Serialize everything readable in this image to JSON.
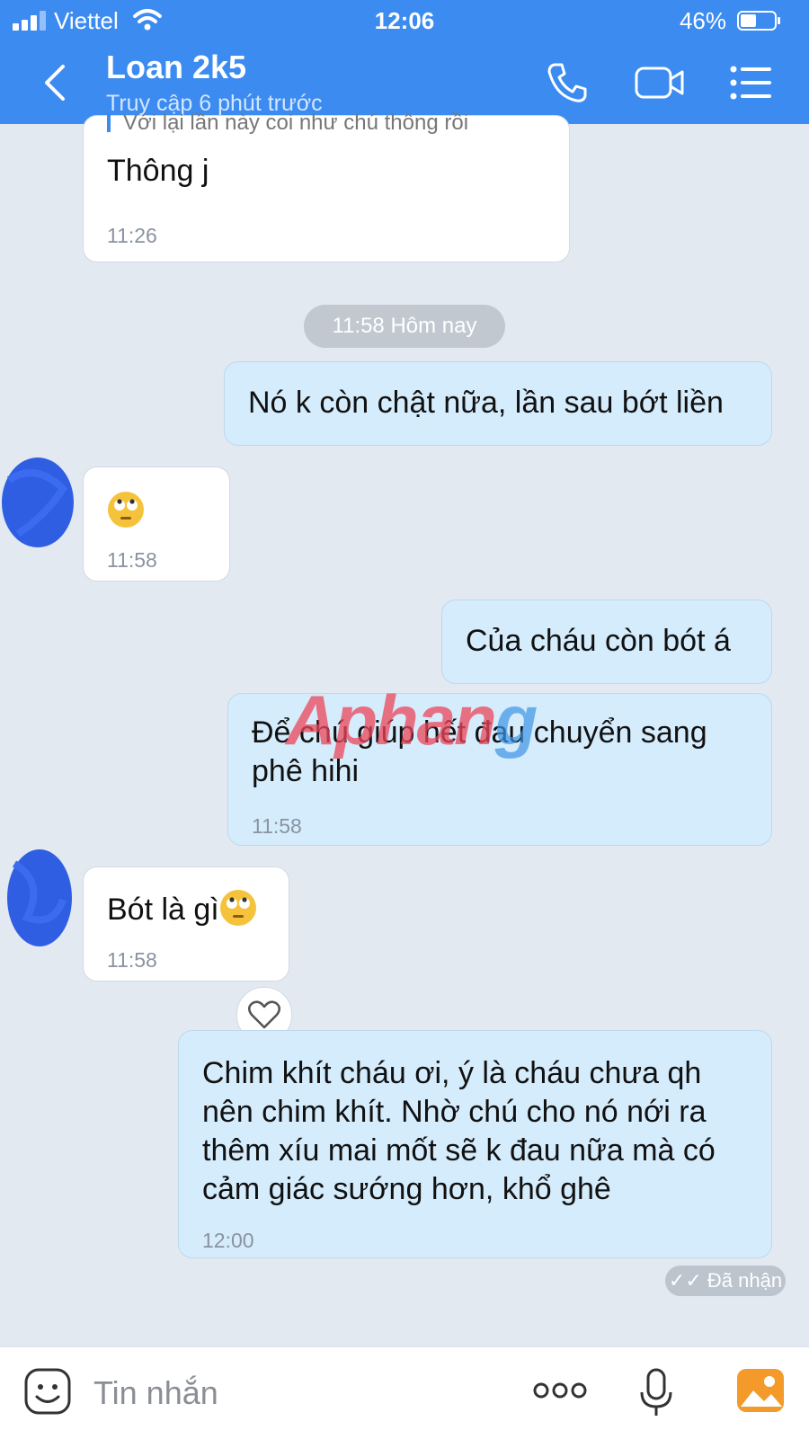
{
  "status_bar": {
    "carrier": "Viettel",
    "time": "12:06",
    "battery": "46%"
  },
  "header": {
    "title": "Loan 2k5",
    "subtitle": "Truy cập 6 phút trước",
    "icons": [
      "back-icon",
      "phone-icon",
      "video-call-icon",
      "menu-icon"
    ]
  },
  "messages": [
    {
      "side": "in",
      "quote": "Với lại lần này coi như chú thông rồi",
      "text": "Thông j",
      "time": "11:26"
    },
    {
      "type": "day",
      "label": "11:58 Hôm nay"
    },
    {
      "side": "out",
      "text": "Nó k còn chật nữa, lần sau bớt liền"
    },
    {
      "side": "in",
      "text": "",
      "emoji": "face-with-rolling-eyes",
      "time": "11:58"
    },
    {
      "side": "out",
      "text": "Của cháu còn bót á"
    },
    {
      "side": "out",
      "text": "Để chú giúp hết đau chuyển sang phê hihi",
      "time": "11:58"
    },
    {
      "side": "in",
      "text": "Bót là gì",
      "emoji": "face-with-rolling-eyes",
      "time": "11:58"
    },
    {
      "side": "out",
      "text": "Chim khít cháu ơi, ý là cháu chưa qh nên chim khít. Nhờ chú cho nó nới ra thêm xíu mai mốt sẽ k đau nữa mà có cảm giác sướng hơn, khổ ghê",
      "time": "12:00"
    }
  ],
  "receipt": "Đã nhận",
  "watermark": {
    "a": "Aphan",
    "b": "g"
  },
  "input": {
    "placeholder": "Tin nhắn"
  },
  "colors": {
    "header": "#3c8bf0",
    "chat_bg": "#e2e9f1",
    "out_bubble": "#d5ecfc",
    "in_bubble": "#ffffff"
  }
}
